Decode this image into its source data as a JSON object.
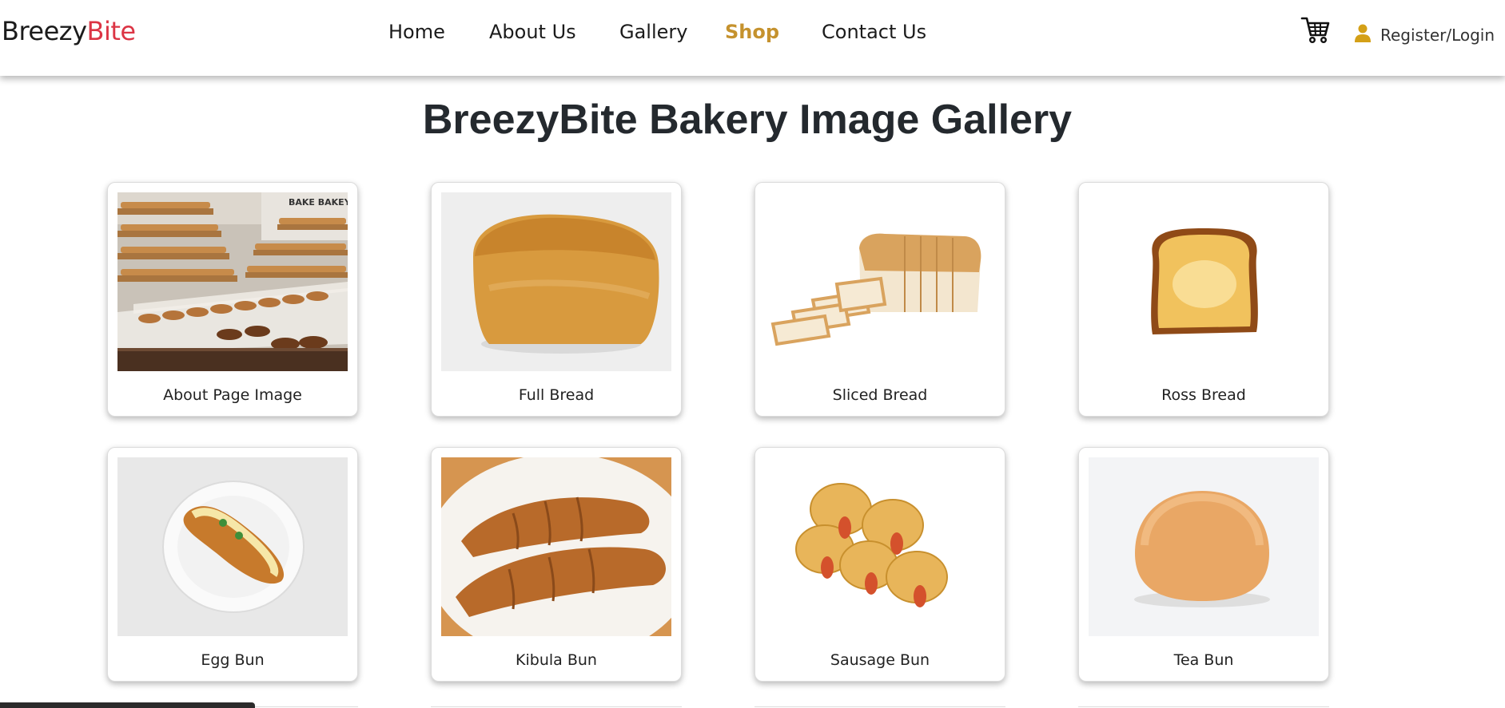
{
  "brand": {
    "name_part1": "Breezy",
    "name_part2": "Bite"
  },
  "nav": {
    "items": [
      {
        "label": "Home"
      },
      {
        "label": "About Us"
      },
      {
        "label": "Gallery"
      },
      {
        "label": "Shop",
        "active": true
      },
      {
        "label": "Contact Us"
      }
    ],
    "active_color": "#c5922e"
  },
  "header_actions": {
    "cart_icon": "cart-icon",
    "login_icon": "user-icon",
    "login_label": "Register/Login"
  },
  "page": {
    "title": "BreezyBite Bakery Image Gallery"
  },
  "gallery": [
    {
      "caption": "About Page Image",
      "image": "bakery-interior"
    },
    {
      "caption": "Full Bread",
      "image": "full-bread"
    },
    {
      "caption": "Sliced Bread",
      "image": "sliced-bread"
    },
    {
      "caption": "Ross Bread",
      "image": "ross-bread"
    },
    {
      "caption": "Egg Bun",
      "image": "egg-bun"
    },
    {
      "caption": "Kibula Bun",
      "image": "kibula-bun"
    },
    {
      "caption": "Sausage Bun",
      "image": "sausage-bun"
    },
    {
      "caption": "Tea Bun",
      "image": "tea-bun"
    }
  ],
  "colors": {
    "brand_accent": "#dc3545",
    "text": "#1b1b1b"
  }
}
